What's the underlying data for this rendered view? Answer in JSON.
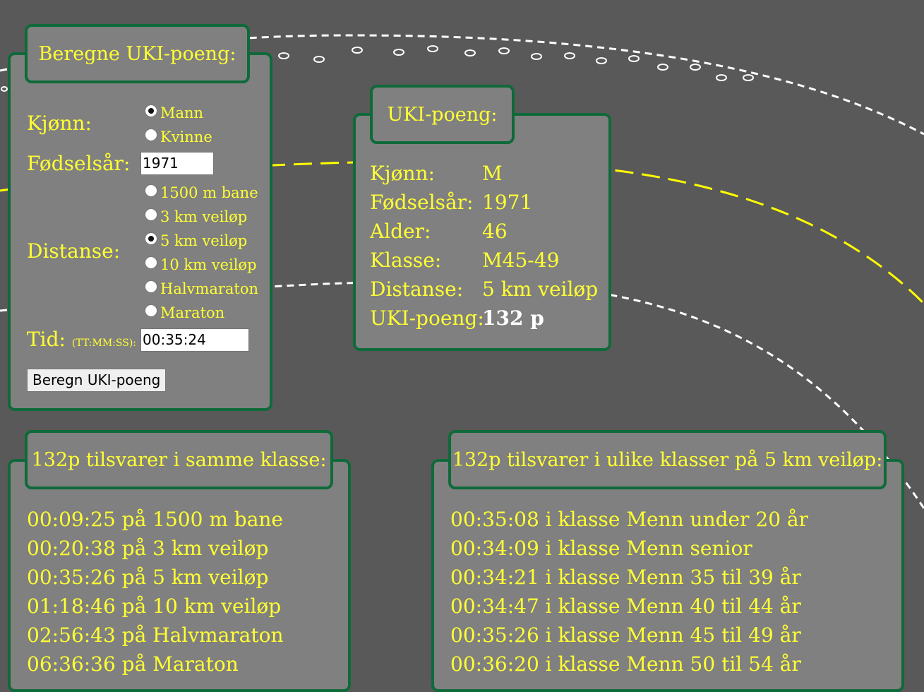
{
  "form": {
    "title": "Beregne UKI-poeng:",
    "gender_label": "Kjønn:",
    "gender_options": [
      {
        "label": "Mann",
        "checked": true
      },
      {
        "label": "Kvinne",
        "checked": false
      }
    ],
    "birth_year_label": "Fødselsår:",
    "birth_year_value": "1971",
    "distance_label": "Distanse:",
    "distance_options": [
      {
        "label": "1500 m bane",
        "checked": false
      },
      {
        "label": "3 km veiløp",
        "checked": false
      },
      {
        "label": "5 km veiløp",
        "checked": true
      },
      {
        "label": "10 km veiløp",
        "checked": false
      },
      {
        "label": "Halvmaraton",
        "checked": false
      },
      {
        "label": "Maraton",
        "checked": false
      }
    ],
    "time_label": "Tid:",
    "time_hint": "(TT:MM:SS):",
    "time_value": "00:35:24",
    "submit_label": "Beregn UKI-poeng"
  },
  "result": {
    "title": "UKI-poeng:",
    "rows": [
      {
        "key": "Kjønn:",
        "value": "M"
      },
      {
        "key": "Fødselsår:",
        "value": "1971"
      },
      {
        "key": "Alder:",
        "value": "46"
      },
      {
        "key": "Klasse:",
        "value": "M45-49"
      },
      {
        "key": "Distanse:",
        "value": "5 km veiløp"
      },
      {
        "key": "UKI-poeng:",
        "value": "132 p"
      }
    ]
  },
  "same_class": {
    "title": "132p tilsvarer i samme klasse:",
    "lines": [
      "00:09:25 på 1500 m bane",
      "00:20:38 på 3 km veiløp",
      "00:35:26 på 5 km veiløp",
      "01:18:46 på 10 km veiløp",
      "02:56:43 på Halvmaraton",
      "06:36:36 på Maraton"
    ]
  },
  "other_classes": {
    "title": "132p tilsvarer i ulike klasser på 5 km veiløp:",
    "lines": [
      "00:35:08 i klasse Menn under 20 år",
      "00:34:09 i klasse Menn senior",
      "00:34:21 i klasse Menn 35 til 39 år",
      "00:34:47 i klasse Menn 40 til 44 år",
      "00:35:26 i klasse Menn 45 til 49 år",
      "00:36:20 i klasse Menn 50 til 54 år"
    ]
  },
  "colors": {
    "background": "#595959",
    "panel": "#808080",
    "border": "#0f6a3a",
    "text": "#ffff33",
    "track_yellow": "#ffff00",
    "track_white": "#ffffff"
  }
}
